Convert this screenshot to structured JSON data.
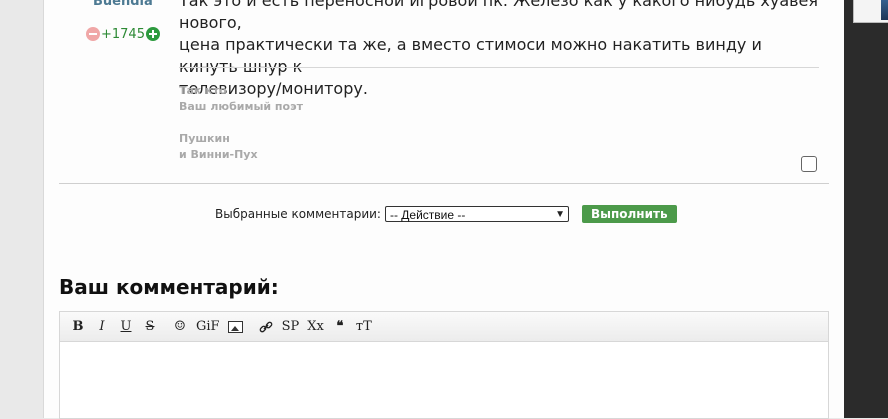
{
  "comment": {
    "author": "Buendia",
    "rating": "+1745",
    "text_lines": [
      "Так это и есть переносной игровой пк. Железо как у какого нибудь хуавея нового,",
      "цена практически та же, а вместо стимоси можно накатить винду и кинуть шнур к",
      "телевизору/монитору."
    ],
    "signature": {
      "line1": "Так кто",
      "line2": "Ваш любимый поэт",
      "line3": "Пушкин",
      "line4": "и Винни-Пух"
    }
  },
  "bulk": {
    "label": "Выбранные комментарии:",
    "select_value": "-- Действие --",
    "button": "Выполнить"
  },
  "reply": {
    "heading": "Ваш комментарий:",
    "toolbar": {
      "bold": "B",
      "italic": "I",
      "underline": "U",
      "strike": "S",
      "smile": "☺",
      "gif": "GiF",
      "image": "image-icon",
      "link": "link-icon",
      "spoiler": "SP",
      "sub": "Xx",
      "quote": "❝",
      "font_size": "тT"
    }
  },
  "icons": {
    "minus": "minus-circle-icon",
    "plus": "plus-circle-icon"
  }
}
